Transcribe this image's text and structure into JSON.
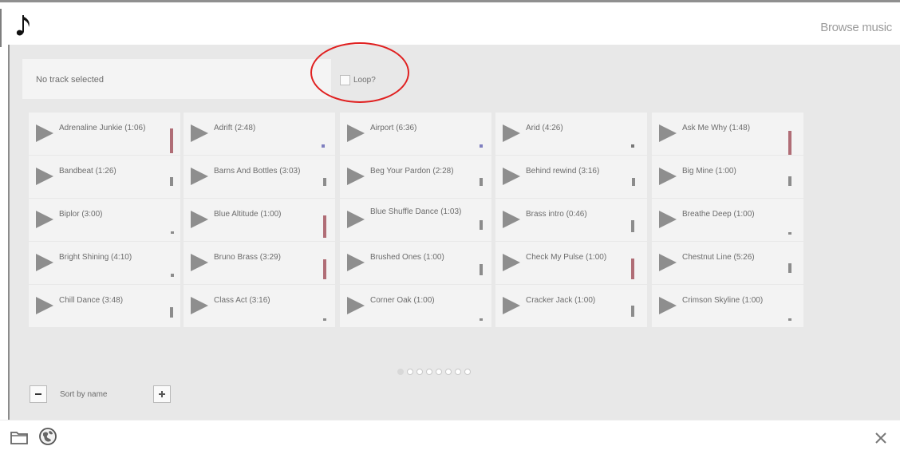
{
  "header": {
    "title": "Browse music"
  },
  "status": {
    "text": "No track selected"
  },
  "loop": {
    "label": "Loop?"
  },
  "tracks": [
    "Adrenaline Junkie (1:06)",
    "Adrift (2:48)",
    "Airport (6:36)",
    "Arid (4:26)",
    "Ask Me Why (1:48)",
    "Bandbeat (1:26)",
    "Barns And Bottles (3:03)",
    "Beg Your Pardon (2:28)",
    "Behind rewind (3:16)",
    "Big Mine (1:00)",
    "Biplor (3:00)",
    "Blue Altitude (1:00)",
    "Blue Shuffle Dance (1:03)",
    "Brass intro (0:46)",
    "Breathe Deep (1:00)",
    "Bright Shining (4:10)",
    "Bruno Brass (3:29)",
    "Brushed Ones (1:00)",
    "Check My Pulse (1:00)",
    "Chestnut Line (5:26)",
    "Chill Dance (3:48)",
    "Class Act (3:16)",
    "Corner Oak (1:00)",
    "Cracker Jack (1:00)",
    "Crimson Skyline (1:00)"
  ],
  "sort": {
    "label": "Sort by name"
  },
  "icons": {
    "app": "music-note-icon",
    "folder": "folder-icon",
    "globe": "globe-icon",
    "close": "close-icon"
  }
}
